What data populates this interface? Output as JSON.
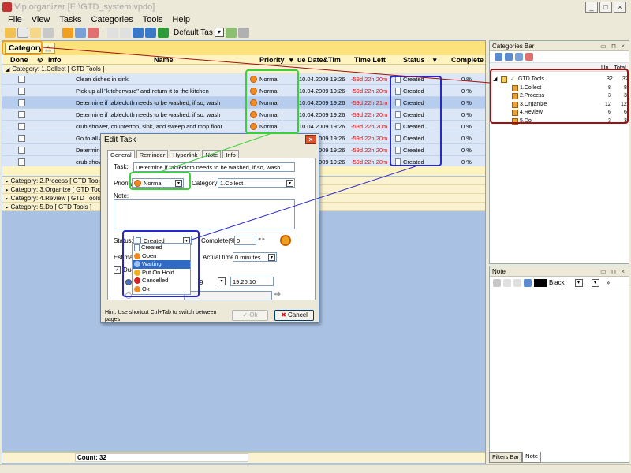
{
  "window": {
    "title": "Vip organizer [E:\\GTD_system.vpdo]",
    "controls": [
      "_",
      "□",
      "×"
    ]
  },
  "menu": [
    "File",
    "View",
    "Tasks",
    "Categories",
    "Tools",
    "Help"
  ],
  "toolbar": {
    "view_name": "Default Tas"
  },
  "grid": {
    "group_by_label": "Category",
    "headers": {
      "done": "Done",
      "info": "Info",
      "name": "Name",
      "priority": "Priority",
      "due": "ue Date&Tim",
      "time_left": "Time Left",
      "status": "Status",
      "complete": "Complete"
    },
    "groups": [
      {
        "label": "Category: 1.Collect   [ GTD Tools ]",
        "expanded": true
      },
      {
        "label": "Category: 2.Process   [ GTD Tools ]",
        "expanded": false
      },
      {
        "label": "Category: 3.Organize   [ GTD Tools ]",
        "expanded": false
      },
      {
        "label": "Category: 4.Review   [ GTD Tools ]",
        "expanded": false
      },
      {
        "label": "Category: 5.Do   [ GTD Tools ]",
        "expanded": false
      }
    ],
    "tasks": [
      {
        "name": "Clean dishes in sink.",
        "priority": "Normal",
        "due": "10.04.2009 19:26",
        "time_left": "-59d 22h 20m",
        "status": "Created",
        "complete": "0 %"
      },
      {
        "name": "Pick up all \"kitcherware\" and return it to the kitchen",
        "priority": "Normal",
        "due": "10.04.2009 19:26",
        "time_left": "-59d 22h 20m",
        "status": "Created",
        "complete": "0 %"
      },
      {
        "name": "Determine if tablecloth needs to be washed, if so, wash",
        "priority": "Normal",
        "due": "10.04.2009 19:26",
        "time_left": "-59d 22h 21m",
        "status": "Created",
        "complete": "0 %"
      },
      {
        "name": "Determine if tablecloth needs to be washed, if so, wash",
        "priority": "Normal",
        "due": "10.04.2009 19:26",
        "time_left": "-59d 22h 20m",
        "status": "Created",
        "complete": "0 %"
      },
      {
        "name": "crub shower, countertop, sink, and sweep and mop floor",
        "priority": "Normal",
        "due": "10.04.2009 19:26",
        "time_left": "-59d 22h 20m",
        "status": "Created",
        "complete": "0 %"
      },
      {
        "name": "Go to all a",
        "priority": "",
        "due": "10.04.2009 19:26",
        "time_left": "-59d 22h 20m",
        "status": "Created",
        "complete": "0 %"
      },
      {
        "name": "Determine",
        "priority": "",
        "due": "10.04.2009 19:26",
        "time_left": "-59d 22h 20m",
        "status": "Created",
        "complete": "0 %"
      },
      {
        "name": "crub show",
        "priority": "",
        "due": "10.04.2009 19:26",
        "time_left": "-59d 22h 20m",
        "status": "Created",
        "complete": "0 %"
      }
    ],
    "count": "Count: 32"
  },
  "categories_bar": {
    "title": "Categories Bar",
    "col_un": "Un...",
    "col_total": "Total",
    "items": [
      {
        "name": "GTD Tools",
        "un": "32",
        "total": "32"
      },
      {
        "name": "1.Collect",
        "un": "8",
        "total": "8"
      },
      {
        "name": "2.Process",
        "un": "3",
        "total": "3"
      },
      {
        "name": "3.Organize",
        "un": "12",
        "total": "12"
      },
      {
        "name": "4.Review",
        "un": "6",
        "total": "6"
      },
      {
        "name": "5.Do",
        "un": "3",
        "total": "3"
      }
    ]
  },
  "note_pane": {
    "title": "Note",
    "color_name": "Black"
  },
  "bottom_tabs": [
    "Filters Bar",
    "Note"
  ],
  "dialog": {
    "title": "Edit Task",
    "tabs": [
      "General",
      "Reminder",
      "Hyperlink",
      "Note",
      "Info"
    ],
    "task_label": "Task:",
    "task_value": "Determine if tablecloth needs to be washed, if so, wash",
    "priority_label": "Priority:",
    "priority_value": "Normal",
    "category_label": "Category:",
    "category_value": "1.Collect",
    "note_label": "Note:",
    "status_label": "Status:",
    "status_value": "Created",
    "complete_label": "Complete(%):",
    "complete_value": "0",
    "estimate_label": "Estimate",
    "actual_time_label": "Actual time:",
    "actual_time_value": "0 minutes",
    "due_label": "Due",
    "due_date_fragment": "9",
    "due_time": "19:26:10",
    "hint": "Hint: Use shortcut Ctrl+Tab to switch between pages",
    "ok_label": "Ok",
    "cancel_label": "Cancel",
    "status_options": [
      {
        "label": "Created",
        "color": "#ffffff"
      },
      {
        "label": "Open",
        "color": "#f08a24"
      },
      {
        "label": "Waiting",
        "color": "#4a8be0"
      },
      {
        "label": "Put On Hold",
        "color": "#f0b020"
      },
      {
        "label": "Cancelled",
        "color": "#d32020"
      },
      {
        "label": "Ok",
        "color": "#f08a24"
      }
    ],
    "status_selected": "Waiting"
  },
  "colors": {
    "accent_orange": "#f0a020",
    "highlight_green": "#39d039",
    "highlight_blue": "#2828c8",
    "highlight_red": "#a01010"
  }
}
